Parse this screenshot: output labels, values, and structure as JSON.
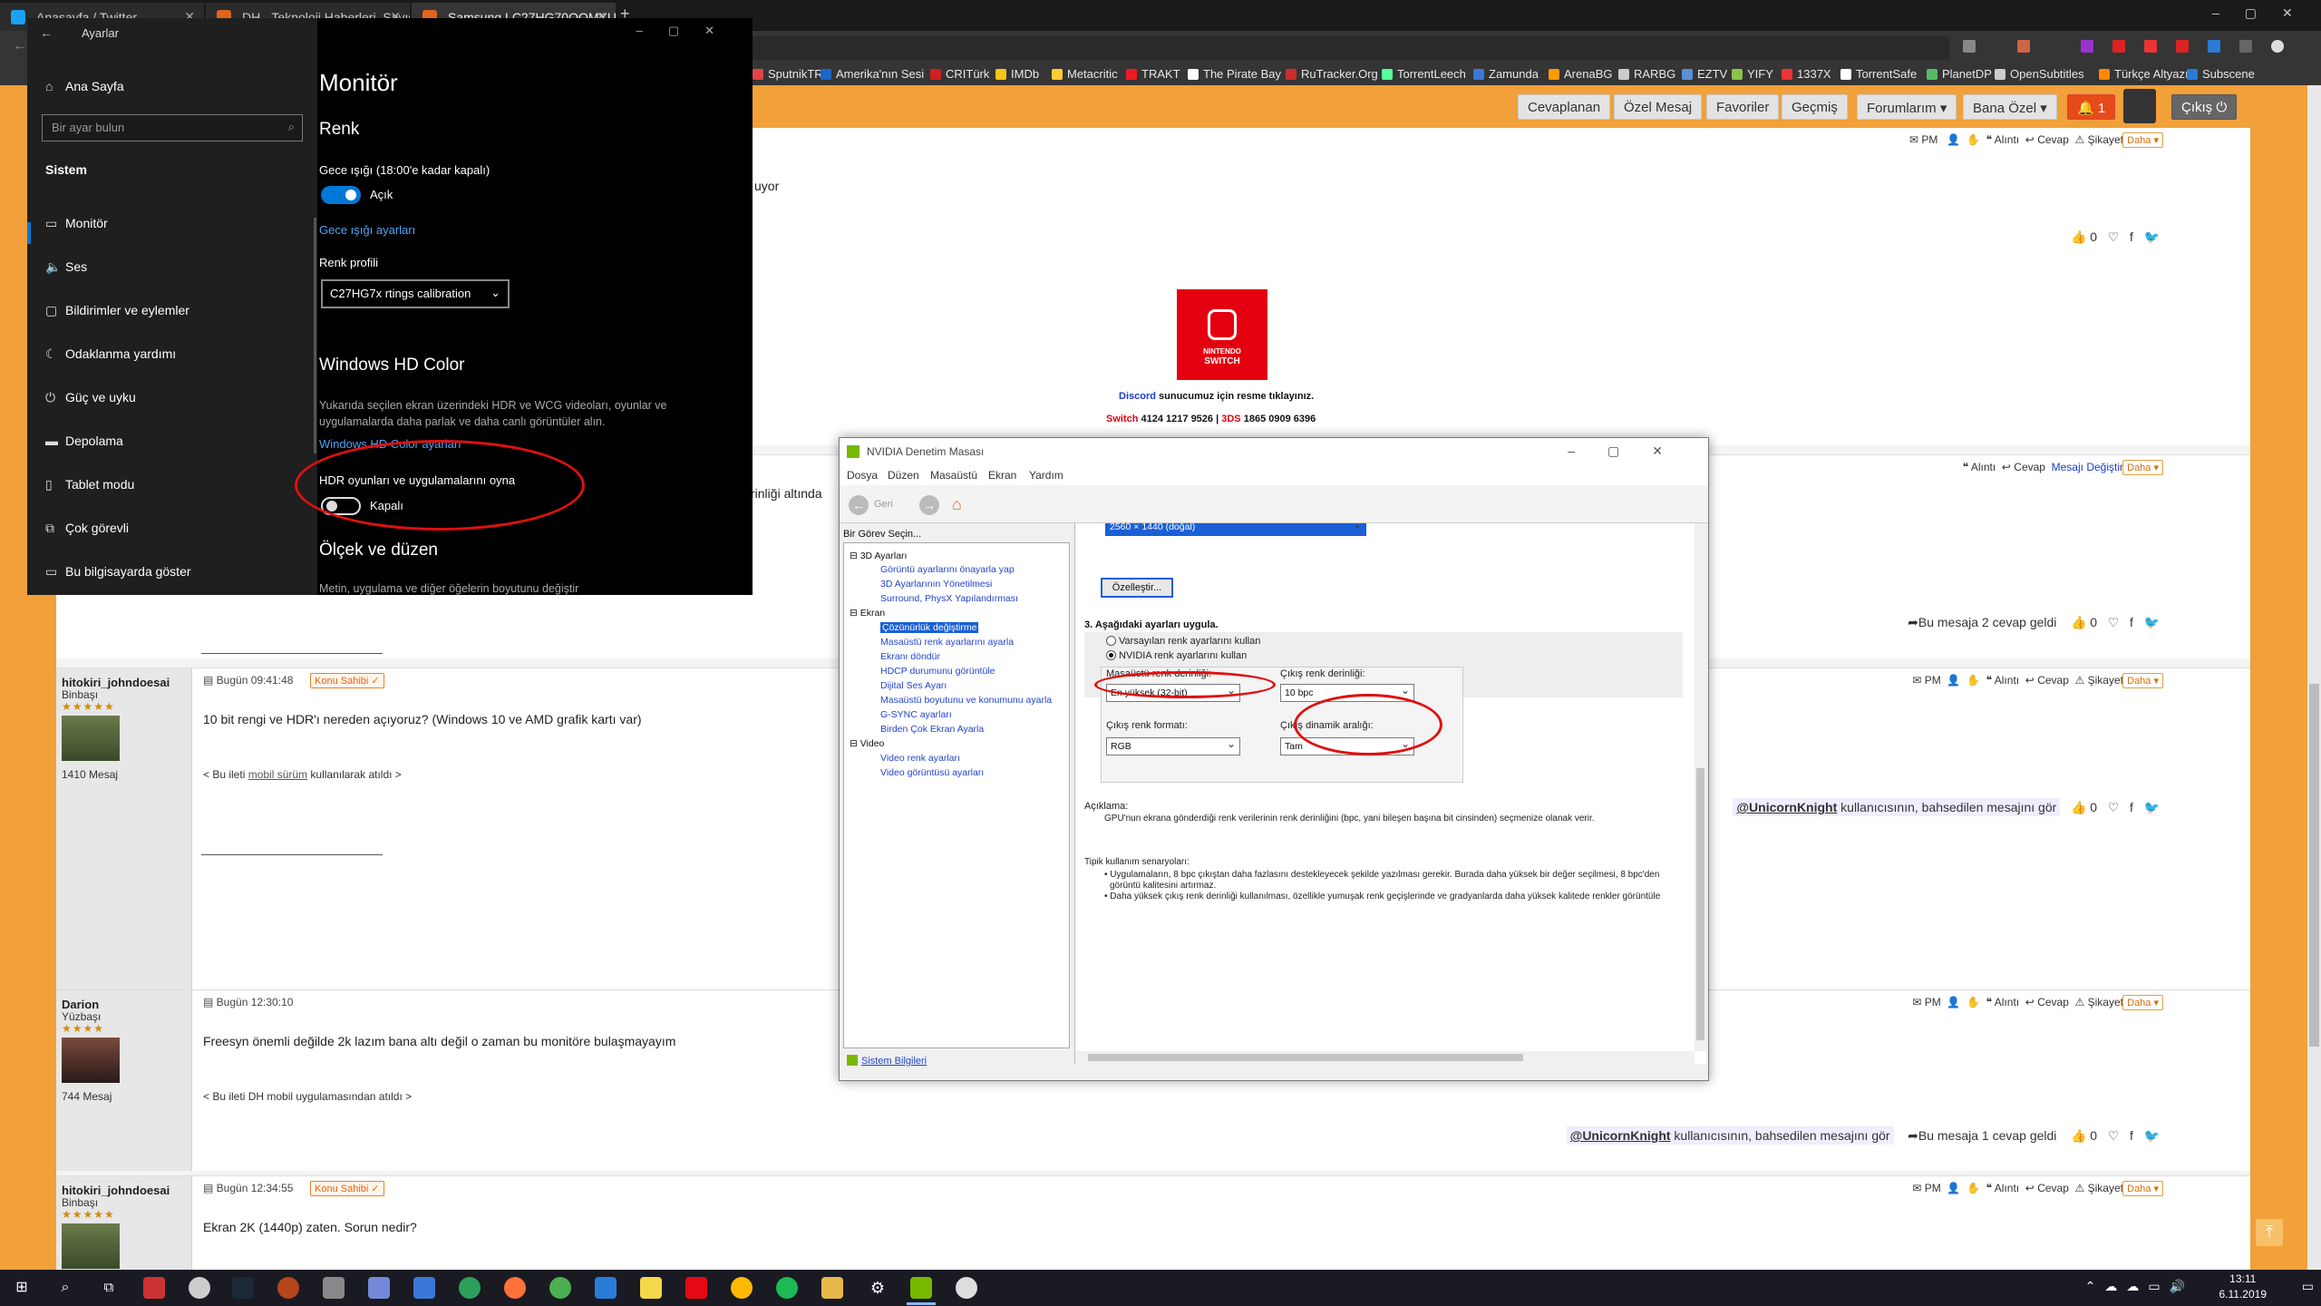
{
  "browser": {
    "tabs": [
      {
        "label": "Anasayfa / Twitter"
      },
      {
        "label": "DH - Teknoloji Haberleri, Sayısa"
      },
      {
        "label": "Samsung LC27HG70QQMXUF"
      }
    ],
    "url": "140675754",
    "bookmarks": [
      "SputnikTR",
      "Amerika'nın Sesi",
      "CRITürk",
      "IMDb",
      "Metacritic",
      "TRAKT",
      "The Pirate Bay",
      "RuTracker.Org",
      "TorrentLeech",
      "Zamunda",
      "ArenaBG",
      "RARBG",
      "EZTV",
      "YIFY",
      "1337X",
      "TorrentSafe",
      "PlanetDP",
      "OpenSubtitles",
      "Türkçe Altyazı",
      "Subscene"
    ]
  },
  "site_nav": {
    "items": [
      "Cevaplanan",
      "Özel Mesaj",
      "Favoriler",
      "Geçmiş",
      "Forumlarım",
      "Bana Özel"
    ],
    "notif_count": "1",
    "logout": "Çıkış"
  },
  "post_actions": {
    "pm": "PM",
    "alinti": "Alıntı",
    "cevap": "Cevap",
    "sikayet": "Şikayet",
    "daha": "Daha",
    "mesaji_degistir": "Mesajı Değiştir"
  },
  "top_fragment": "uyor",
  "fragment2": "rinliği altında",
  "discord_line": {
    "discord": "Discord",
    "rest": "sunucumuz için resme tıklayınız."
  },
  "switch_line": {
    "switch": "Switch",
    "switch_code": "4124 1217 9526",
    "sep": "|",
    "ds": "3DS",
    "ds_code": "1865 0909 6396"
  },
  "nintendo_logo": {
    "line1": "NINTENDO",
    "line2": "SWITCH"
  },
  "reply_counters": {
    "r1": "Bu mesaja 2 cevap geldi",
    "r2": "Bu mesaja 1 cevap geldi"
  },
  "like_count": "0",
  "blocked_user": {
    "name": "@UnicornKnight",
    "text": "kullanıcısının, bahsedilen mesajını gör"
  },
  "posts": [
    {
      "user": "hitokiri_johndoesai",
      "rank": "Binbaşı",
      "stars": "★★★★★",
      "count": "1410 Mesaj",
      "date": "Bugün 09:41:48",
      "badge": "Konu Sahibi",
      "text": "10 bit rengi ve HDR'ı nereden açıyoruz? (Windows 10 ve AMD grafik kartı var)",
      "footer_pre": "< Bu ileti",
      "footer_link": "mobil sürüm",
      "footer_post": "kullanılarak atıldı >"
    },
    {
      "user": "Darion",
      "rank": "Yüzbaşı",
      "stars": "★★★★",
      "count": "744 Mesaj",
      "date": "Bugün 12:30:10",
      "text": "Freesyn önemli değilde 2k lazım bana altı değil o zaman bu monitöre bulaşmayayım",
      "footer": "< Bu ileti DH mobil uygulamasından atıldı >"
    },
    {
      "user": "hitokiri_johndoesai",
      "rank": "Binbaşı",
      "stars": "★★★★★",
      "date": "Bugün 12:34:55",
      "badge": "Konu Sahibi",
      "text": "Ekran 2K (1440p) zaten. Sorun nedir?"
    }
  ],
  "settings": {
    "window_title": "Ayarlar",
    "home": "Ana Sayfa",
    "search_placeholder": "Bir ayar bulun",
    "section": "Sistem",
    "nav": [
      "Monitör",
      "Ses",
      "Bildirimler ve eylemler",
      "Odaklanma yardımı",
      "Güç ve uyku",
      "Depolama",
      "Tablet modu",
      "Çok görevli",
      "Bu bilgisayarda göster"
    ],
    "page_title": "Monitör",
    "color_heading": "Renk",
    "night_light": "Gece ışığı (18:00'e kadar kapalı)",
    "night_state": "Açık",
    "night_link": "Gece ışığı ayarları",
    "profile_label": "Renk profili",
    "profile_value": "C27HG7x rtings calibration",
    "hd_heading": "Windows HD Color",
    "hd_desc1": "Yukarıda seçilen ekran üzerindeki HDR ve WCG videoları, oyunlar ve",
    "hd_desc2": "uygulamalarda daha parlak ve daha canlı görüntüler alın.",
    "hd_link": "Windows HD Color ayarları",
    "hdr_label": "HDR oyunları ve uygulamalarını oyna",
    "hdr_state": "Kapalı",
    "scale_heading": "Ölçek ve düzen",
    "scale_desc": "Metin, uygulama ve diğer öğelerin boyutunu değiştir"
  },
  "nvidia": {
    "title": "NVIDIA Denetim Masası",
    "menu": [
      "Dosya",
      "Düzen",
      "Masaüstü",
      "Ekran",
      "Yardım"
    ],
    "back": "Geri",
    "task_label": "Bir Görev Seçin...",
    "tree": {
      "g1": "3D Ayarları",
      "g1_items": [
        "Görüntü ayarlarını önayarla yap",
        "3D Ayarlarının Yönetilmesi",
        "Surround, PhysX Yapılandırması"
      ],
      "g2": "Ekran",
      "g2_items": [
        "Çözünürlük değiştirme",
        "Masaüstü renk ayarlarını ayarla",
        "Ekranı döndür",
        "HDCP durumunu görüntüle",
        "Dijital Ses Ayarı",
        "Masaüstü boyutunu ve konumunu ayarla",
        "G-SYNC ayarları",
        "Birden Çok Ekran Ayarla"
      ],
      "g3": "Video",
      "g3_items": [
        "Video renk ayarları",
        "Video görüntüsü ayarları"
      ]
    },
    "system_info": "Sistem Bilgileri",
    "resolution": "2560 × 1440 (doğal)",
    "customize": "Özelleştir...",
    "step3": "3. Aşağıdaki ayarları uygula.",
    "radio_default": "Varsayılan renk ayarlarını kullan",
    "radio_nvidia": "NVIDIA renk ayarlarını kullan",
    "desktop_depth_label": "Masaüstü renk derinliği:",
    "desktop_depth": "En yüksek (32-bit)",
    "output_depth_label": "Çıkış renk derinliği:",
    "output_depth": "10 bpc",
    "output_format_label": "Çıkış renk formatı:",
    "output_format": "RGB",
    "output_range_label": "Çıkış dinamik aralığı:",
    "output_range": "Tam",
    "desc_head": "Açıklama:",
    "desc": "GPU'nun ekrana gönderdiği renk verilerinin renk derinliğini (bpc, yani bileşen başına bit cinsinden) seçmenize olanak verir.",
    "usage_head": "Tipik kullanım senaryoları:",
    "usage1": "• Uygulamaların, 8 bpc çıkıştan daha fazlasını destekleyecek şekilde yazılması gerekir. Burada daha yüksek bir değer seçilmesi, 8 bpc'den",
    "usage1b": "görüntü kalitesini artırmaz.",
    "usage2": "• Daha yüksek çıkış renk derinliği kullanılması, özellikle yumuşak renk geçişlerinde ve gradyanlarda daha yüksek kalitede renkler görüntüle"
  },
  "taskbar": {
    "time": "13:11",
    "date": "6.11.2019"
  },
  "colors": {
    "accent_orange": "#f1a03a",
    "win_blue": "#0078d7",
    "nv_green": "#76b900",
    "red_annot": "#e01010"
  }
}
